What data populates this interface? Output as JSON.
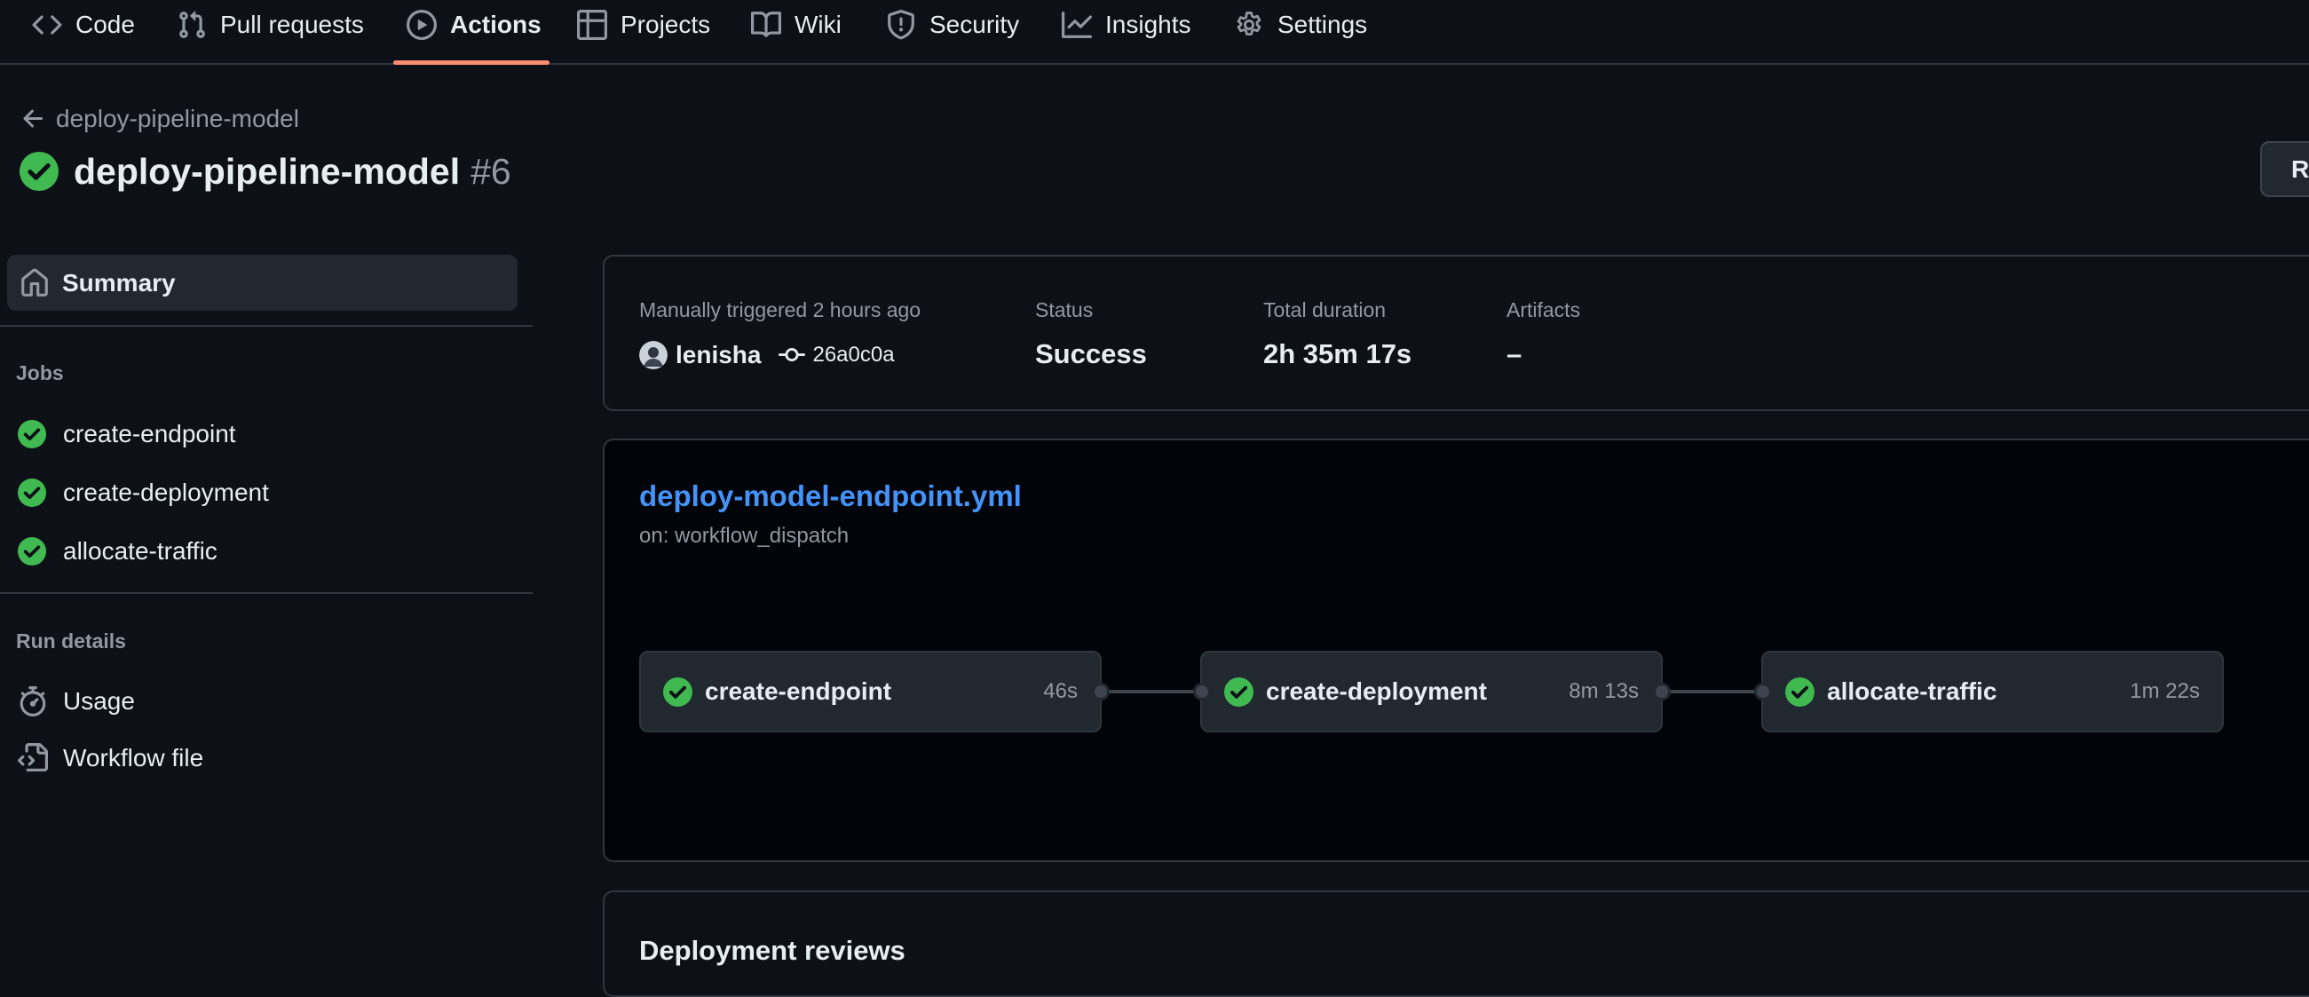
{
  "nav": {
    "tabs": [
      {
        "label": "Code",
        "icon": "code-icon"
      },
      {
        "label": "Pull requests",
        "icon": "pull-request-icon"
      },
      {
        "label": "Actions",
        "icon": "play-icon",
        "active": true
      },
      {
        "label": "Projects",
        "icon": "table-icon"
      },
      {
        "label": "Wiki",
        "icon": "book-icon"
      },
      {
        "label": "Security",
        "icon": "shield-icon"
      },
      {
        "label": "Insights",
        "icon": "graph-icon"
      },
      {
        "label": "Settings",
        "icon": "gear-icon"
      }
    ]
  },
  "header": {
    "back_label": "deploy-pipeline-model",
    "title": "deploy-pipeline-model",
    "run_number": "#6",
    "rerun_label": "Re"
  },
  "sidebar": {
    "summary_label": "Summary",
    "jobs_heading": "Jobs",
    "jobs": [
      {
        "label": "create-endpoint",
        "status": "success"
      },
      {
        "label": "create-deployment",
        "status": "success"
      },
      {
        "label": "allocate-traffic",
        "status": "success"
      }
    ],
    "run_details_heading": "Run details",
    "run_details": [
      {
        "label": "Usage",
        "icon": "stopwatch-icon"
      },
      {
        "label": "Workflow file",
        "icon": "file-code-icon"
      }
    ]
  },
  "summary": {
    "trigger_text": "Manually triggered 2 hours ago",
    "actor": "lenisha",
    "commit": "26a0c0a",
    "status_label": "Status",
    "status_value": "Success",
    "duration_label": "Total duration",
    "duration_value": "2h 35m 17s",
    "artifacts_label": "Artifacts",
    "artifacts_value": "–"
  },
  "workflow": {
    "file": "deploy-model-endpoint.yml",
    "trigger": "on: workflow_dispatch",
    "jobs": [
      {
        "name": "create-endpoint",
        "duration": "46s"
      },
      {
        "name": "create-deployment",
        "duration": "8m 13s"
      },
      {
        "name": "allocate-traffic",
        "duration": "1m 22s"
      }
    ]
  },
  "reviews": {
    "title": "Deployment reviews"
  },
  "colors": {
    "background": "#0d1117",
    "success": "#3fb950",
    "link": "#4493f8",
    "active_tab_underline": "#fd8c73"
  }
}
